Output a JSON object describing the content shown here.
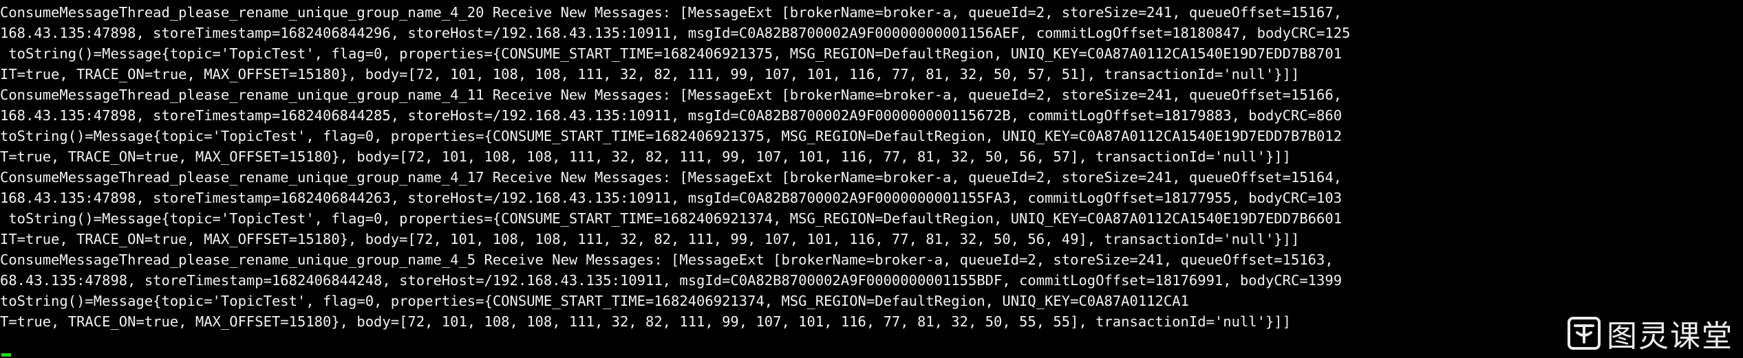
{
  "terminal": {
    "lines": [
      "ConsumeMessageThread_please_rename_unique_group_name_4_20 Receive New Messages: [MessageExt [brokerName=broker-a, queueId=2, storeSize=241, queueOffset=15167,",
      "168.43.135:47898, storeTimestamp=1682406844296, storeHost=/192.168.43.135:10911, msgId=C0A82B8700002A9F00000000001156AEF, commitLogOffset=18180847, bodyCRC=125",
      " toString()=Message{topic='TopicTest', flag=0, properties={CONSUME_START_TIME=1682406921375, MSG_REGION=DefaultRegion, UNIQ_KEY=C0A87A0112CA1540E19D7EDD7B8701",
      "IT=true, TRACE_ON=true, MAX_OFFSET=15180}, body=[72, 101, 108, 108, 111, 32, 82, 111, 99, 107, 101, 116, 77, 81, 32, 50, 57, 51], transactionId='null'}]]",
      "ConsumeMessageThread_please_rename_unique_group_name_4_11 Receive New Messages: [MessageExt [brokerName=broker-a, queueId=2, storeSize=241, queueOffset=15166,",
      "168.43.135:47898, storeTimestamp=1682406844285, storeHost=/192.168.43.135:10911, msgId=C0A82B8700002A9F000000000115672B, commitLogOffset=18179883, bodyCRC=860",
      "toString()=Message{topic='TopicTest', flag=0, properties={CONSUME_START_TIME=1682406921375, MSG_REGION=DefaultRegion, UNIQ_KEY=C0A87A0112CA1540E19D7EDD7B7B012",
      "T=true, TRACE_ON=true, MAX_OFFSET=15180}, body=[72, 101, 108, 108, 111, 32, 82, 111, 99, 107, 101, 116, 77, 81, 32, 50, 56, 57], transactionId='null'}]]",
      "ConsumeMessageThread_please_rename_unique_group_name_4_17 Receive New Messages: [MessageExt [brokerName=broker-a, queueId=2, storeSize=241, queueOffset=15164,",
      "168.43.135:47898, storeTimestamp=1682406844263, storeHost=/192.168.43.135:10911, msgId=C0A82B8700002A9F0000000001155FA3, commitLogOffset=18177955, bodyCRC=103",
      " toString()=Message{topic='TopicTest', flag=0, properties={CONSUME_START_TIME=1682406921374, MSG_REGION=DefaultRegion, UNIQ_KEY=C0A87A0112CA1540E19D7EDD7B6601",
      "IT=true, TRACE_ON=true, MAX_OFFSET=15180}, body=[72, 101, 108, 108, 111, 32, 82, 111, 99, 107, 101, 116, 77, 81, 32, 50, 56, 49], transactionId='null'}]]",
      "ConsumeMessageThread_please_rename_unique_group_name_4_5 Receive New Messages: [MessageExt [brokerName=broker-a, queueId=2, storeSize=241, queueOffset=15163,",
      "68.43.135:47898, storeTimestamp=1682406844248, storeHost=/192.168.43.135:10911, msgId=C0A82B8700002A9F0000000001155BDF, commitLogOffset=18176991, bodyCRC=1399",
      "toString()=Message{topic='TopicTest', flag=0, properties={CONSUME_START_TIME=1682406921374, MSG_REGION=DefaultRegion, UNIQ_KEY=C0A87A0112CA1",
      "T=true, TRACE_ON=true, MAX_OFFSET=15180}, body=[72, 101, 108, 108, 111, 32, 82, 111, 99, 107, 101, 116, 77, 81, 32, 50, 55, 55], transactionId='null'}]]"
    ],
    "cursor_color": "#20d420",
    "text_color": "#f2f2f2",
    "background": "#000000"
  },
  "watermark": {
    "text": "图灵课堂",
    "icon": "turing-logo-icon"
  }
}
